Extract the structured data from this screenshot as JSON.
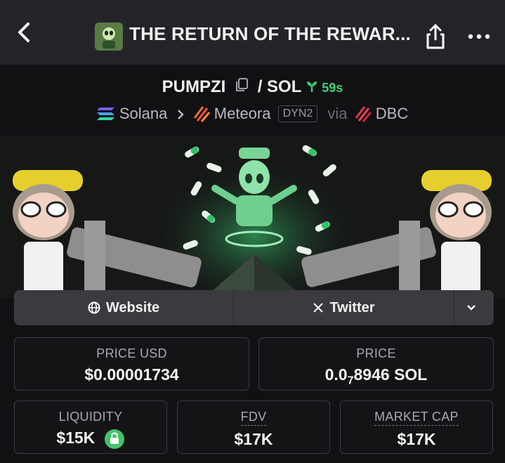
{
  "header": {
    "title": "THE RETURN OF THE REWAR..."
  },
  "pair": {
    "base": "PUMPZI",
    "separator": "/",
    "quote": "SOL",
    "age": "59s"
  },
  "chain": {
    "chain_name": "Solana",
    "dex_name": "Meteora",
    "dex_tag": "DYN2",
    "via_label": "via",
    "via_name": "DBC"
  },
  "links": {
    "website_label": "Website",
    "twitter_label": "Twitter"
  },
  "stats": {
    "price_usd_label": "PRICE USD",
    "price_usd_value": "$0.00001734",
    "price_label": "PRICE",
    "price_value_prefix": "0.0",
    "price_value_subscript": "7",
    "price_value_suffix": "8946 SOL",
    "liquidity_label": "LIQUIDITY",
    "liquidity_value": "$15K",
    "fdv_label": "FDV",
    "fdv_value": "$17K",
    "market_cap_label": "MARKET CAP",
    "market_cap_value": "$17K"
  },
  "colors": {
    "accent_green": "#3fce73",
    "background": "#111114",
    "header_bg": "#242428"
  }
}
